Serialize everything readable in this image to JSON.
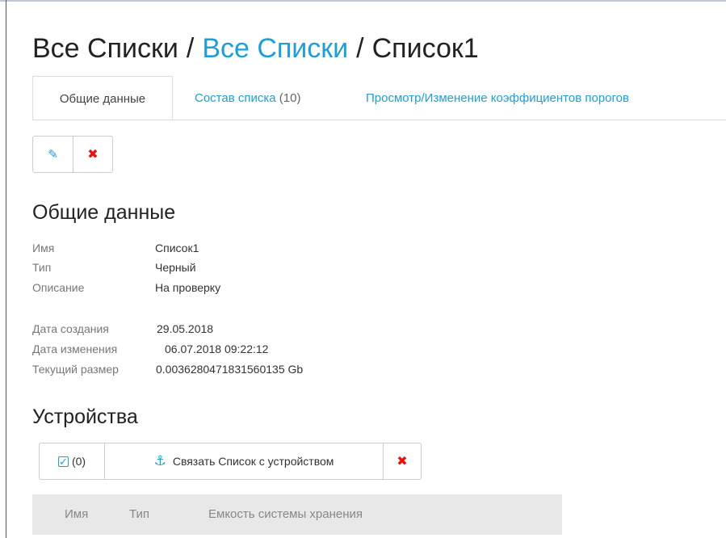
{
  "breadcrumb": {
    "root": "Все Списки",
    "sep1": "/",
    "link": "Все Списки",
    "sep2": "/",
    "current": "Список1"
  },
  "tabs": [
    {
      "label": "Общие данные"
    },
    {
      "label": "Состав списка",
      "count": "(10)"
    },
    {
      "label": "Просмотр/Изменение коэффициентов порогов"
    }
  ],
  "toolbar": {
    "edit_icon": "✎",
    "delete_icon": "✖"
  },
  "general": {
    "title": "Общие данные",
    "fields": [
      {
        "label": "Имя",
        "value": "Список1"
      },
      {
        "label": "Тип",
        "value": "Черный"
      },
      {
        "label": "Описание",
        "value": "На проверку"
      }
    ],
    "meta": [
      {
        "label": "Дата создания",
        "value": "29.05.2018"
      },
      {
        "label": "Дата изменения",
        "value": "06.07.2018 09:22:12"
      },
      {
        "label": "Текущий размер",
        "value": "0.003628047183156013​5 Gb"
      }
    ]
  },
  "devices": {
    "title": "Устройства",
    "select_count": "(0)",
    "link_label": "Связать Список с устройством",
    "columns": [
      "Имя",
      "Тип",
      "Емкость системы хранения"
    ]
  },
  "colors": {
    "accent": "#1e9fd6",
    "danger": "#e8140b",
    "table_header_bg": "#e8e8e8"
  }
}
